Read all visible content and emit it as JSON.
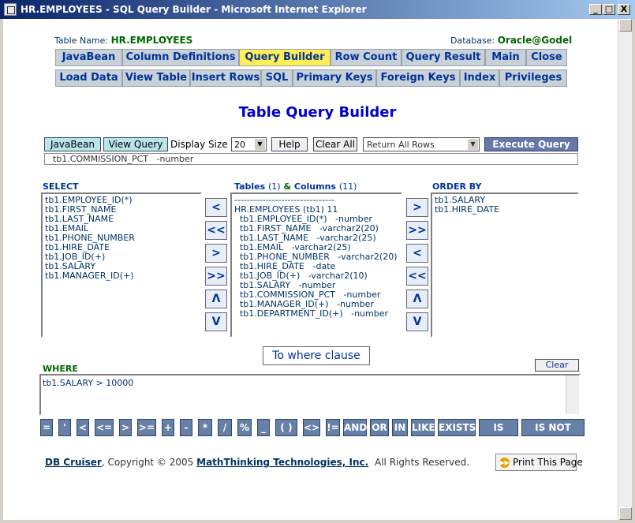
{
  "window": {
    "title": "HR.EMPLOYEES - SQL Query Builder - Microsoft Internet Explorer",
    "controls": [
      "_",
      "□",
      "X"
    ]
  },
  "header": {
    "table_label": "Table Name:",
    "table_name": "HR.EMPLOYEES",
    "db_label": "Database:",
    "db_name": "Oracle@Godel"
  },
  "tabs_row1": [
    "JavaBean",
    "Column Definitions",
    "Query Builder",
    "Row Count",
    "Query Result",
    "Main",
    "Close"
  ],
  "tabs_row2": [
    "Load Data",
    "View Table",
    "Insert Rows",
    "SQL",
    "Primary Keys",
    "Foreign Keys",
    "Index",
    "Privileges"
  ],
  "page_title": "Table Query Builder",
  "toolbar": {
    "javabean": "JavaBean",
    "view_query": "View Query",
    "display_size_label": "Display Size",
    "display_size": "20",
    "help": "Help",
    "clear_all": "Clear All",
    "mode": "Return All Rows",
    "execute": "Execute Query"
  },
  "status_line": "tb1.COMMISSION_PCT   -number",
  "select": {
    "header": "SELECT",
    "items": [
      "tb1.EMPLOYEE_ID(*)",
      "tb1.FIRST_NAME",
      "tb1.LAST_NAME",
      "tb1.EMAIL",
      "tb1.PHONE_NUMBER",
      "tb1.HIRE_DATE",
      "tb1.JOB_ID(+)",
      "tb1.SALARY",
      "tb1.MANAGER_ID(+)"
    ]
  },
  "tables": {
    "header_a": "Tables",
    "header_b": "(1)",
    "header_c": "&",
    "header_d": "Columns",
    "header_e": "(11)",
    "items": [
      "--------------------------------",
      "HR.EMPLOYEES (tb1) 11",
      "  tb1.EMPLOYEE_ID(*)   -number",
      "  tb1.FIRST_NAME   -varchar2(20)",
      "  tb1.LAST_NAME   -varchar2(25)",
      "  tb1.EMAIL   -varchar2(25)",
      "  tb1.PHONE_NUMBER   -varchar2(20)",
      "  tb1.HIRE_DATE   -date",
      "  tb1.JOB_ID(+)   -varchar2(10)",
      "  tb1.SALARY   -number",
      "  tb1.COMMISSION_PCT   -number",
      "  tb1.MANAGER_ID(+)   -number",
      "  tb1.DEPARTMENT_ID(+)   -number"
    ]
  },
  "order_by": {
    "header": "ORDER BY",
    "items": [
      "tb1.SALARY",
      "tb1.HIRE_DATE"
    ]
  },
  "left_arrows": [
    "<",
    "<<",
    ">",
    ">>",
    "Λ",
    "V"
  ],
  "right_arrows": [
    ">",
    ">>",
    "<",
    "<<",
    "Λ",
    "V"
  ],
  "to_where": "To where clause",
  "where": {
    "header": "WHERE",
    "clear": "Clear",
    "text": "tb1.SALARY > 10000"
  },
  "operators": [
    "=",
    "'",
    "<",
    "<=",
    ">",
    ">=",
    "+",
    "-",
    "*",
    "/",
    "%",
    "_",
    "( )",
    "<>",
    "!=",
    "AND",
    "OR",
    "IN",
    "LIKE",
    "EXISTS",
    "IS NULL",
    "IS NOT NULL"
  ],
  "footer": {
    "app": "DB Cruiser",
    "copyright": ",  Copyright © 2005",
    "company": "MathThinking Technologies, Inc.",
    "rights": "All Rights Reserved.",
    "print": "Print This Page"
  }
}
